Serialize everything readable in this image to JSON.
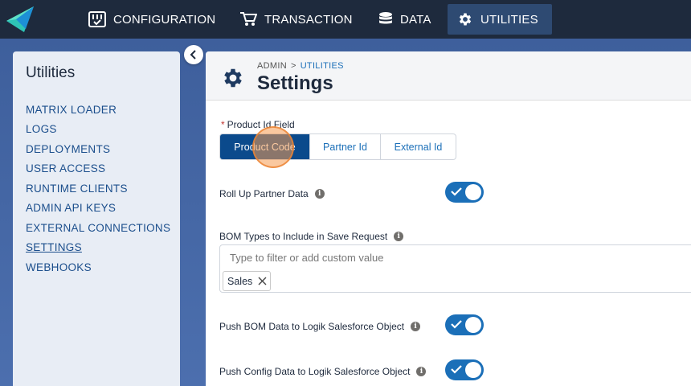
{
  "nav": {
    "configuration": "CONFIGURATION",
    "transaction": "TRANSACTION",
    "data": "DATA",
    "utilities": "UTILITIES"
  },
  "sidebar": {
    "title": "Utilities",
    "items": [
      {
        "label": "MATRIX LOADER"
      },
      {
        "label": "LOGS"
      },
      {
        "label": "DEPLOYMENTS"
      },
      {
        "label": "USER ACCESS"
      },
      {
        "label": "RUNTIME CLIENTS"
      },
      {
        "label": "ADMIN API KEYS"
      },
      {
        "label": "EXTERNAL CONNECTIONS"
      },
      {
        "label": "SETTINGS",
        "active": true
      },
      {
        "label": "WEBHOOKS"
      }
    ]
  },
  "header": {
    "breadcrumb_root": "ADMIN",
    "breadcrumb_sep": ">",
    "breadcrumb_current": "UTILITIES",
    "title": "Settings"
  },
  "form": {
    "product_id": {
      "required_mark": "*",
      "label": "Product Id Field",
      "options": [
        "Product Code",
        "Partner Id",
        "External Id"
      ],
      "selected": "Product Code"
    },
    "roll_up": {
      "label": "Roll Up Partner Data",
      "enabled": true
    },
    "bom_types": {
      "label": "BOM Types to Include in Save Request",
      "placeholder": "Type to filter or add custom value",
      "value": "",
      "tags": [
        "Sales"
      ]
    },
    "push_bom": {
      "label": "Push BOM Data to Logik Salesforce Object",
      "enabled": true
    },
    "push_config": {
      "label": "Push Config Data to Logik Salesforce Object",
      "enabled": true
    }
  },
  "icons": {
    "info": "i"
  },
  "colors": {
    "topbar": "#1e2a3d",
    "accent": "#1b6fb8",
    "selected": "#0b4a8c"
  }
}
